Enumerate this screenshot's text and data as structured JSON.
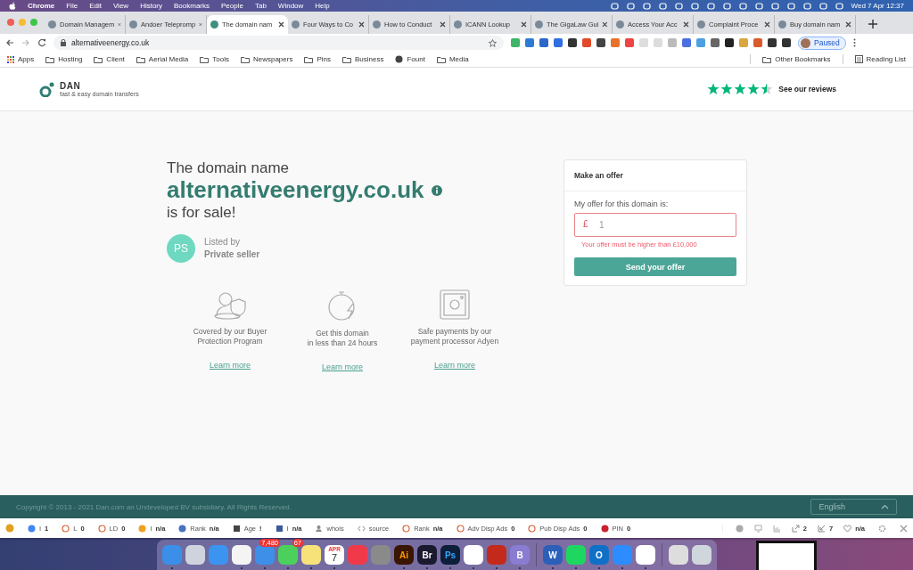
{
  "menubar": {
    "menus": [
      "Chrome",
      "File",
      "Edit",
      "View",
      "History",
      "Bookmarks",
      "People",
      "Tab",
      "Window",
      "Help"
    ],
    "clock": "Wed 7 Apr  12:37"
  },
  "tabs": [
    {
      "title": "Domain Managem",
      "selected": false
    },
    {
      "title": "Andoer Telepromp",
      "selected": false
    },
    {
      "title": "The domain nam",
      "selected": true
    },
    {
      "title": "Four Ways to Co",
      "selected": false
    },
    {
      "title": "How to Conduct",
      "selected": false
    },
    {
      "title": "ICANN Lookup",
      "selected": false
    },
    {
      "title": "The GigaLaw Gui",
      "selected": false
    },
    {
      "title": "Access Your Acc",
      "selected": false
    },
    {
      "title": "Complaint Proce",
      "selected": false
    },
    {
      "title": "Buy domain nam",
      "selected": false
    }
  ],
  "toolbar": {
    "url": "alternativeenergy.co.uk",
    "profile": "Paused"
  },
  "bookmarks": {
    "items": [
      {
        "label": "Apps",
        "kind": "apps"
      },
      {
        "label": "Hosting",
        "kind": "folder"
      },
      {
        "label": "Client",
        "kind": "folder"
      },
      {
        "label": "Aerial Media",
        "kind": "folder"
      },
      {
        "label": "Tools",
        "kind": "folder"
      },
      {
        "label": "Newspapers",
        "kind": "folder"
      },
      {
        "label": "Pins",
        "kind": "folder"
      },
      {
        "label": "Business",
        "kind": "folder"
      },
      {
        "label": "Fount",
        "kind": "globe"
      },
      {
        "label": "Media",
        "kind": "folder"
      }
    ],
    "other": "Other Bookmarks",
    "reading_list": "Reading List"
  },
  "site_header": {
    "logo": "DAN",
    "tagline": "fast & easy domain transfers",
    "rating": {
      "stars": 4.5
    },
    "reviews_link": "See our reviews"
  },
  "hero": {
    "intro": "The domain name",
    "domain": "alternativeenergy.co.uk",
    "outro": "is for sale!",
    "seller_initials": "PS",
    "listed_by": "Listed by",
    "seller": "Private seller"
  },
  "offer": {
    "title": "Make an offer",
    "label": "My offer for this domain is:",
    "currency": "£",
    "value": "1",
    "invalid": true,
    "error": "Your offer must be higher than £10,000",
    "button": "Send your offer"
  },
  "features": [
    {
      "kind": "shield",
      "text": "Covered by our Buyer\nProtection Program",
      "link": "Learn more"
    },
    {
      "kind": "timer",
      "text": "Get this domain\nin less than 24 hours",
      "link": "Learn more"
    },
    {
      "kind": "safe",
      "text": "Safe payments by our\npayment processor Adyen",
      "link": "Learn more"
    }
  ],
  "footer": {
    "copyright": "Copyright © 2013 - 2021 Dan.com an Undeveloped BV subsidiary. All Rights Reserved.",
    "language": "English"
  },
  "seo_bar": {
    "items": [
      {
        "kind": "google",
        "label": "I",
        "value": "1"
      },
      {
        "kind": "ring",
        "label": "L",
        "value": "0"
      },
      {
        "kind": "ring",
        "label": "LD",
        "value": "0"
      },
      {
        "kind": "bing",
        "label": "I",
        "value": "n/a"
      },
      {
        "kind": "globe",
        "label": "Rank",
        "value": "n/a"
      },
      {
        "kind": "calendar",
        "label": "Age",
        "value": "!"
      },
      {
        "kind": "facebook",
        "label": "I",
        "value": "n/a"
      },
      {
        "kind": "person",
        "label": "whois"
      },
      {
        "kind": "code",
        "label": "source"
      },
      {
        "kind": "ring",
        "label": "Rank",
        "value": "n/a"
      },
      {
        "kind": "ring",
        "label": "Adv Disp Ads",
        "value": "0"
      },
      {
        "kind": "ring",
        "label": "Pub Disp Ads",
        "value": "0"
      },
      {
        "kind": "pinterest",
        "label": "PIN",
        "value": "0"
      }
    ],
    "stats": [
      {
        "kind": "info"
      },
      {
        "kind": "monitor"
      },
      {
        "kind": "chart"
      },
      {
        "kind": "external",
        "value": "2"
      },
      {
        "kind": "internal",
        "value": "7"
      },
      {
        "kind": "heart",
        "value": "n/a"
      }
    ]
  },
  "dock": [
    {
      "kind": "finder",
      "running": true
    },
    {
      "kind": "launchpad",
      "running": false
    },
    {
      "kind": "safari",
      "running": false
    },
    {
      "kind": "photos",
      "running": true
    },
    {
      "kind": "mail",
      "badge": "7,480",
      "running": true
    },
    {
      "kind": "messages",
      "badge": "67",
      "running": true
    },
    {
      "kind": "notes",
      "running": true
    },
    {
      "kind": "calendar",
      "month": "APR",
      "day": "7",
      "running": true
    },
    {
      "kind": "news",
      "running": false
    },
    {
      "kind": "settings",
      "running": false
    },
    {
      "kind": "illustrator",
      "label": "Ai",
      "running": true
    },
    {
      "kind": "bridge",
      "label": "Br",
      "running": true
    },
    {
      "kind": "photoshop",
      "label": "Ps",
      "running": true
    },
    {
      "kind": "chrome",
      "running": true
    },
    {
      "kind": "acrobat",
      "running": true
    },
    {
      "kind": "bbedit",
      "label": "B",
      "running": true
    },
    {
      "kind": "word",
      "label": "W",
      "running": true
    },
    {
      "kind": "spotify",
      "running": true
    },
    {
      "kind": "outlook",
      "label": "O",
      "running": true
    },
    {
      "kind": "zoom",
      "running": true
    },
    {
      "kind": "messenger",
      "running": true
    },
    {
      "kind": "preview",
      "running": false
    },
    {
      "kind": "trash",
      "running": false
    }
  ]
}
